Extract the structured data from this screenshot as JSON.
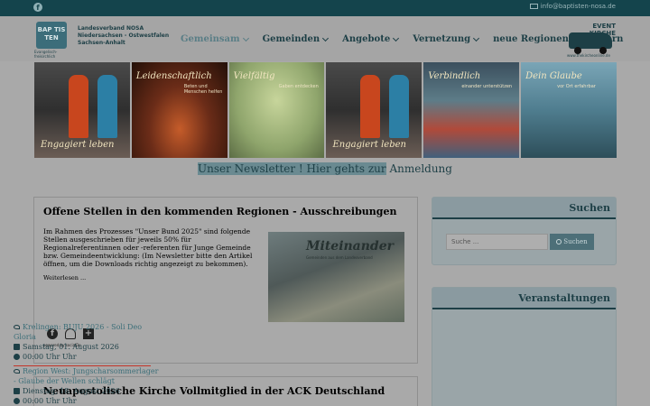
{
  "topbar": {
    "email": "info@baptisten-nosa.de"
  },
  "header": {
    "logo_text": "BAP TIS TEN",
    "logo_sub": "Evangelisch-freikirchlich",
    "org_line1": "Landesverband NOSA",
    "org_line2": "Niedersachsen - Ostwestfalen",
    "org_line3": "Sachsen-Anhalt",
    "event_title": "EVENT KIRCHE",
    "event_url": "www.thekircheonline.de"
  },
  "nav": [
    "Gemeinsam",
    "Gemeinden",
    "Angebote",
    "Vernetzung",
    "neue Regionen",
    "Intern"
  ],
  "tiles": [
    {
      "top": "",
      "sub": "",
      "bottom": "Engagiert leben"
    },
    {
      "top": "Leidenschaftlich",
      "sub": "Beten und Menschen helfen",
      "bottom": ""
    },
    {
      "top": "Vielfältig",
      "sub": "Gaben entdecken",
      "bottom": ""
    },
    {
      "top": "",
      "sub": "",
      "bottom": "Engagiert leben"
    },
    {
      "top": "Verbindlich",
      "sub": "einander unterstützen",
      "bottom": ""
    },
    {
      "top": "Dein Glaube",
      "sub": "vor Ort erfahrbar",
      "bottom": ""
    }
  ],
  "newsletter": {
    "text": "Unser Newsletter ! Hier gehts zur",
    "link": "Anmeldung"
  },
  "article1": {
    "title": "Offene Stellen in den kommenden Regionen - Ausschreibungen",
    "body": "Im Rahmen des Prozesses \"Unser Bund 2025\" sind folgende Stellen ausgeschrieben für jeweils 50% für Regionalreferentinnen oder -referenten für Junge Gemeinde bzw. Gemeindeentwicklung: (Im Newsletter bitte den Artikel öffnen, um die Downloads richtig angezeigt zu bekommen).",
    "more": "Weiterlesen ...",
    "image_title": "Miteinander",
    "image_sub": "Gemeinden aus dem Landesverband",
    "powered": "powered by socialDs"
  },
  "article2": {
    "title": "Neuapostolische Kirche Vollmitglied in der ACK Deutschland"
  },
  "search": {
    "title": "Suchen",
    "placeholder": "Suche ...",
    "button": "Suchen"
  },
  "events": {
    "title": "Veranstaltungen",
    "items": [
      {
        "title": "Krelingen: BUJU 2026 - Soli Deo Gloria",
        "date": "Samstag, 01. August 2026",
        "time": "00:00 Uhr Uhr"
      },
      {
        "title": "Region West: Jungscharsommerlager - Glaube der Wellen schlägt",
        "date": "Dienstag, 18. August 2026",
        "time": "00:00 Uhr Uhr"
      }
    ]
  }
}
